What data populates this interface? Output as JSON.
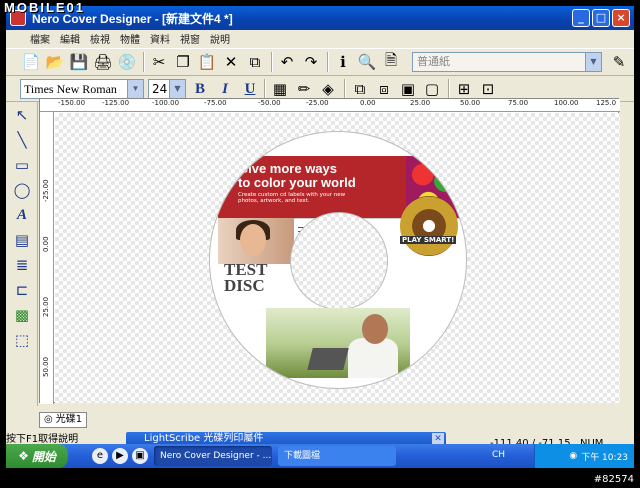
{
  "window": {
    "title": "Nero Cover Designer - [新建文件4 *]",
    "controls": {
      "minimize": "_",
      "maximize": "□",
      "close": "×"
    }
  },
  "menu": {
    "items": [
      "檔案",
      "編輯",
      "檢視",
      "物體",
      "資料",
      "視窗",
      "說明"
    ]
  },
  "toolbar": {
    "paper_placeholder": "普通紙",
    "icons": [
      "new-icon",
      "open-icon",
      "save-icon",
      "print-icon",
      "lightscribe-icon",
      "cut-icon",
      "copy-icon",
      "paste-icon",
      "delete-icon",
      "duplicate-icon",
      "undo-icon",
      "redo-icon",
      "info-icon",
      "zoom-icon",
      "print-preview-icon"
    ]
  },
  "format": {
    "font": "Times New Roman",
    "size": "24",
    "bold": "B",
    "italic": "I",
    "underline": "U"
  },
  "ruler": {
    "h_labels": [
      "-150.00",
      "-125.00",
      "-100.00",
      "-75.00",
      "-50.00",
      "-25.00",
      "0.00",
      "25.00",
      "50.00",
      "75.00",
      "100.00",
      "125.0"
    ],
    "v_labels": [
      "-25.00",
      "0.00",
      "25.00",
      "50.00"
    ]
  },
  "disc": {
    "banner_title": "Give more ways\nto color your world",
    "banner_sub": "Create custom cd labels with your new photos, artwork, and text.",
    "play_label": "PLAY SMART!",
    "label_text": "TEST\nDISC"
  },
  "tabs": {
    "disc": "光碟1"
  },
  "status": {
    "help": "按下F1取得說明",
    "popup": "LightScribe 光碟列印屬件",
    "coords": "-111.40 / -71.15",
    "num": "NUM"
  },
  "taskbar": {
    "start": "開始",
    "tasks": [
      "Nero Cover Designer - ...",
      "下載圖檔"
    ],
    "lang": "CH",
    "clock": "下午 10:23"
  },
  "overlay": {
    "logo": "MOBILE01",
    "watermark": "#82574"
  }
}
